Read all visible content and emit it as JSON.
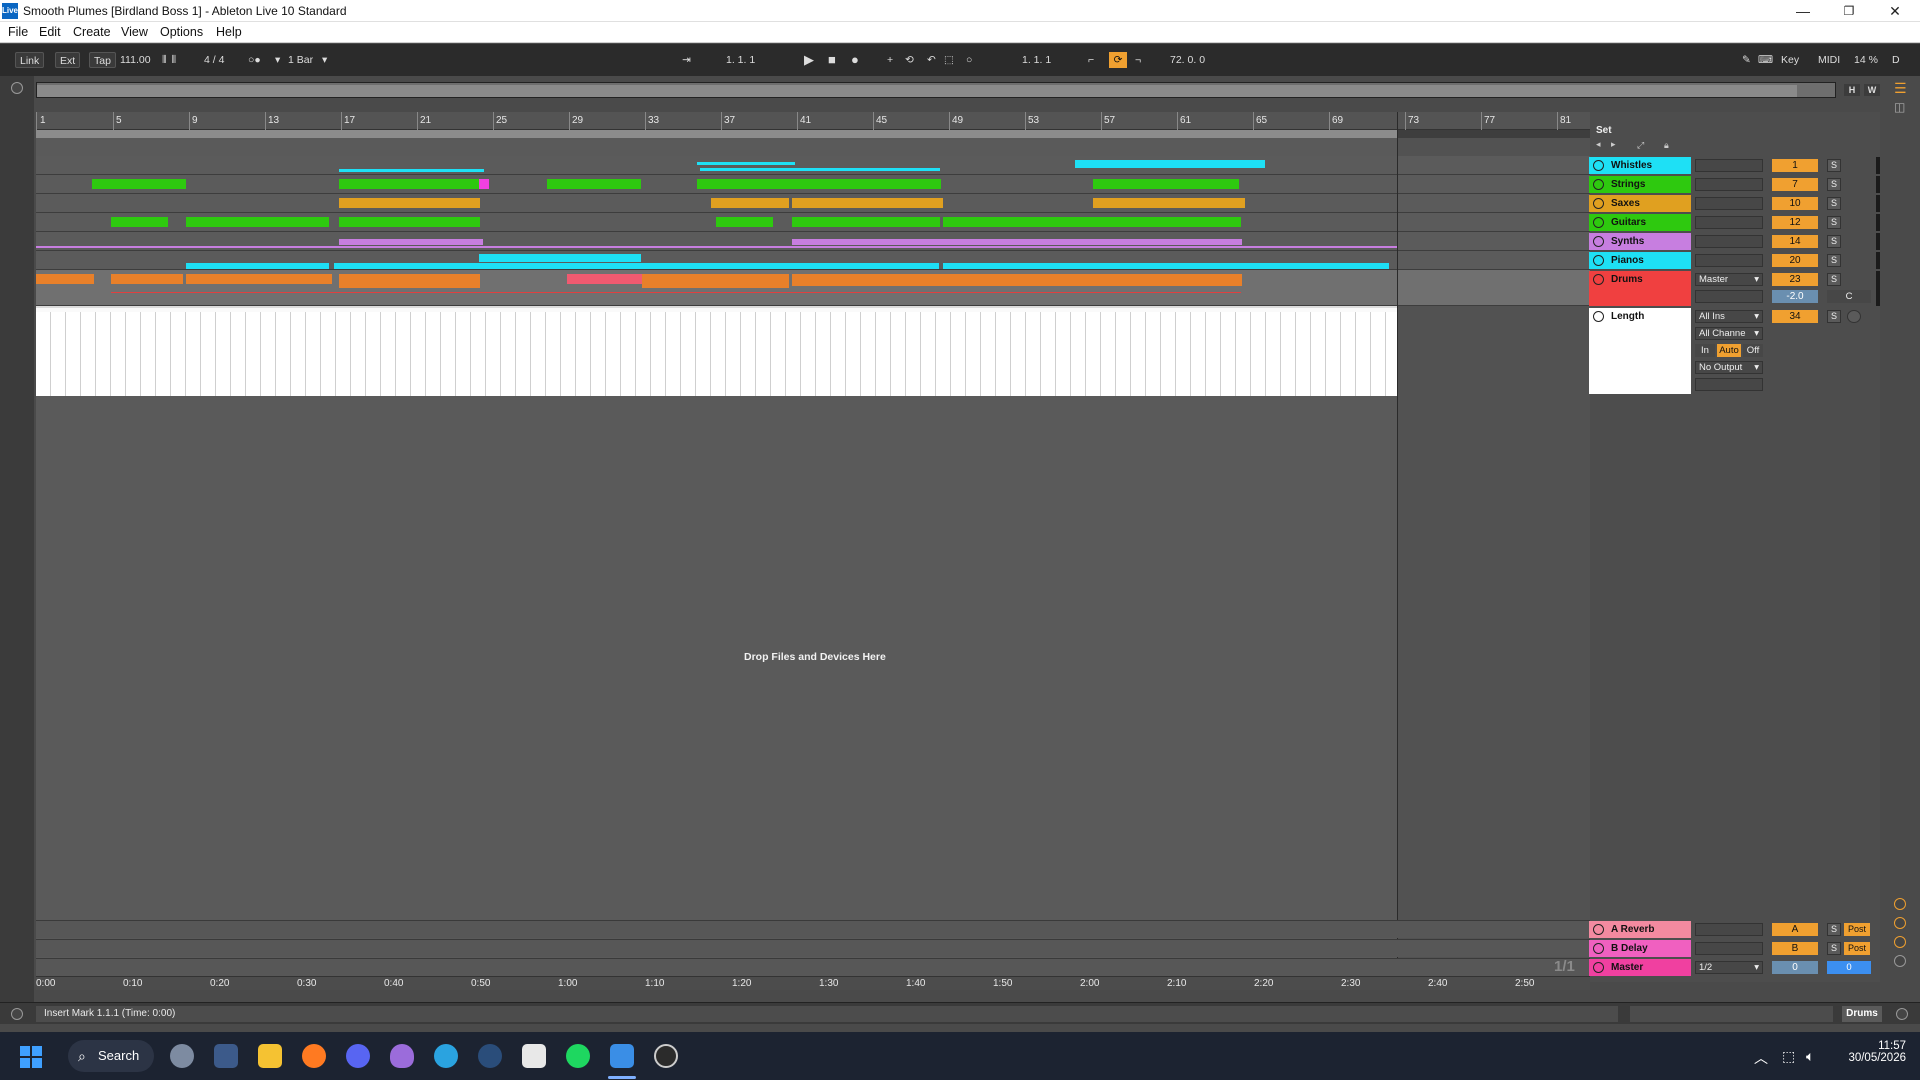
{
  "window": {
    "title": "Smooth Plumes  [Birdland Boss 1] - Ableton Live 10 Standard",
    "logo": "Live",
    "minimize": "—",
    "restore": "❐",
    "close": "✕"
  },
  "menu": [
    "File",
    "Edit",
    "Create",
    "View",
    "Options",
    "Help"
  ],
  "control_bar": {
    "link": "Link",
    "ext": "Ext",
    "tap": "Tap",
    "tempo": "111.00",
    "time_sig": "4 / 4",
    "quantize": "1 Bar",
    "arrangement_position": "1.   1.   1",
    "loop_start": "1.   1.   1",
    "loop_length": "72.   0.   0",
    "key": "Key",
    "midi": "MIDI",
    "cpu": "14 %",
    "d": "D"
  },
  "overview": {
    "h": "H",
    "w": "W"
  },
  "ruler": {
    "bars": [
      "1",
      "5",
      "9",
      "13",
      "17",
      "21",
      "25",
      "29",
      "33",
      "37",
      "41",
      "45",
      "49",
      "53",
      "57",
      "61",
      "65",
      "69",
      "73",
      "77",
      "81"
    ]
  },
  "tracks": [
    {
      "name": "Whistles",
      "color": "#1ee0f5",
      "volume": "1",
      "solo": "S"
    },
    {
      "name": "Strings",
      "color": "#2ec90f",
      "volume": "7",
      "solo": "S"
    },
    {
      "name": "Saxes",
      "color": "#e0a020",
      "volume": "10",
      "solo": "S"
    },
    {
      "name": "Guitars",
      "color": "#2ec90f",
      "volume": "12",
      "solo": "S"
    },
    {
      "name": "Synths",
      "color": "#c77ee0",
      "volume": "14",
      "solo": "S"
    },
    {
      "name": "Pianos",
      "color": "#1ee0f5",
      "volume": "20",
      "solo": "S"
    },
    {
      "name": "Drums",
      "color": "#f04040",
      "volume": "23",
      "solo": "S",
      "output": "Master",
      "pan_value": "-2.0",
      "pan": "C"
    }
  ],
  "length_track": {
    "name": "Length",
    "input": "All Ins",
    "channel": "All Channe",
    "monitor_in": "In",
    "monitor_auto": "Auto",
    "monitor_off": "Off",
    "output": "No Output",
    "volume": "34",
    "solo": "S"
  },
  "set_panel": {
    "label": "Set"
  },
  "drop_hint": "Drop Files and Devices Here",
  "returns": [
    {
      "name": "A Reverb",
      "color": "#f38aa0",
      "send": "A",
      "solo": "S",
      "post": "Post"
    },
    {
      "name": "B Delay",
      "color": "#f060c0",
      "send": "B",
      "solo": "S",
      "post": "Post"
    },
    {
      "name": "Master",
      "color": "#f040a0",
      "output": "1/2",
      "vol": "0",
      "pan": "0"
    }
  ],
  "page_counter": "1/1",
  "time_ruler": [
    "0:00",
    "0:10",
    "0:20",
    "0:30",
    "0:40",
    "0:50",
    "1:00",
    "1:10",
    "1:20",
    "1:30",
    "1:40",
    "1:50",
    "2:00",
    "2:10",
    "2:20",
    "2:30",
    "2:40",
    "2:50"
  ],
  "status": {
    "text": "Insert Mark 1.1.1 (Time: 0:00)",
    "track": "Drums"
  },
  "taskbar": {
    "search": "Search",
    "time": "11:57",
    "date": "30/05/2026"
  }
}
